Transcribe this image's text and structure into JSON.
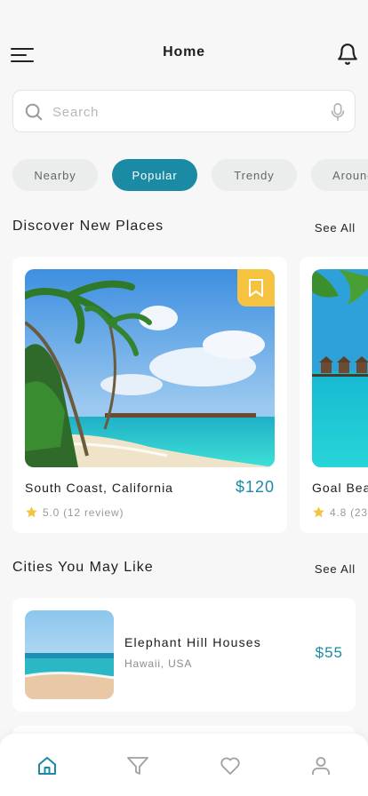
{
  "header": {
    "title": "Home",
    "menu_icon": "menu-icon",
    "bell_icon": "bell-icon"
  },
  "search": {
    "placeholder": "Search",
    "value": "",
    "search_icon": "search-icon",
    "mic_icon": "mic-icon"
  },
  "categories": [
    {
      "label": "Nearby",
      "active": false
    },
    {
      "label": "Popular",
      "active": true
    },
    {
      "label": "Trendy",
      "active": false
    },
    {
      "label": "Around",
      "active": false
    }
  ],
  "discover": {
    "title": "Discover New Places",
    "see_all": "See All",
    "places": [
      {
        "name": "South Coast, California",
        "price": "$120",
        "rating": "5.0",
        "reviews": "(12 review)",
        "bookmark_icon": "bookmark-icon"
      },
      {
        "name": "Goal Beach",
        "price": "",
        "rating": "4.8",
        "reviews": "(23",
        "bookmark_icon": ""
      }
    ]
  },
  "cities": {
    "title": "Cities You May Like",
    "see_all": "See All",
    "items": [
      {
        "name": "Elephant Hill Houses",
        "location": "Hawaii, USA",
        "price": "$55"
      }
    ]
  },
  "bottom_nav": [
    {
      "icon": "home-icon",
      "active": true
    },
    {
      "icon": "filter-icon",
      "active": false
    },
    {
      "icon": "heart-icon",
      "active": false
    },
    {
      "icon": "profile-icon",
      "active": false
    }
  ],
  "colors": {
    "accent": "#1a8aa5",
    "bookmark": "#f6c341",
    "star": "#f6c341",
    "chip_bg": "#ebecec"
  }
}
